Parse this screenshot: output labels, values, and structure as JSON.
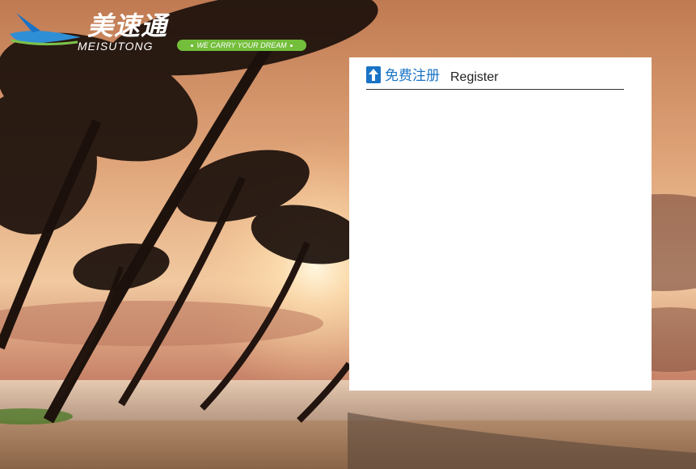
{
  "brand": {
    "name_cn": "美速通",
    "name_en": "MEISUTONG",
    "slogan": "WE CARRY YOUR DREAM"
  },
  "register_panel": {
    "title_cn": "免费注册",
    "title_en": "Register",
    "icon": "up-arrow-icon"
  },
  "colors": {
    "accent_blue": "#1a73c6",
    "slogan_green": "#73be3b",
    "panel_bg": "#ffffff"
  }
}
